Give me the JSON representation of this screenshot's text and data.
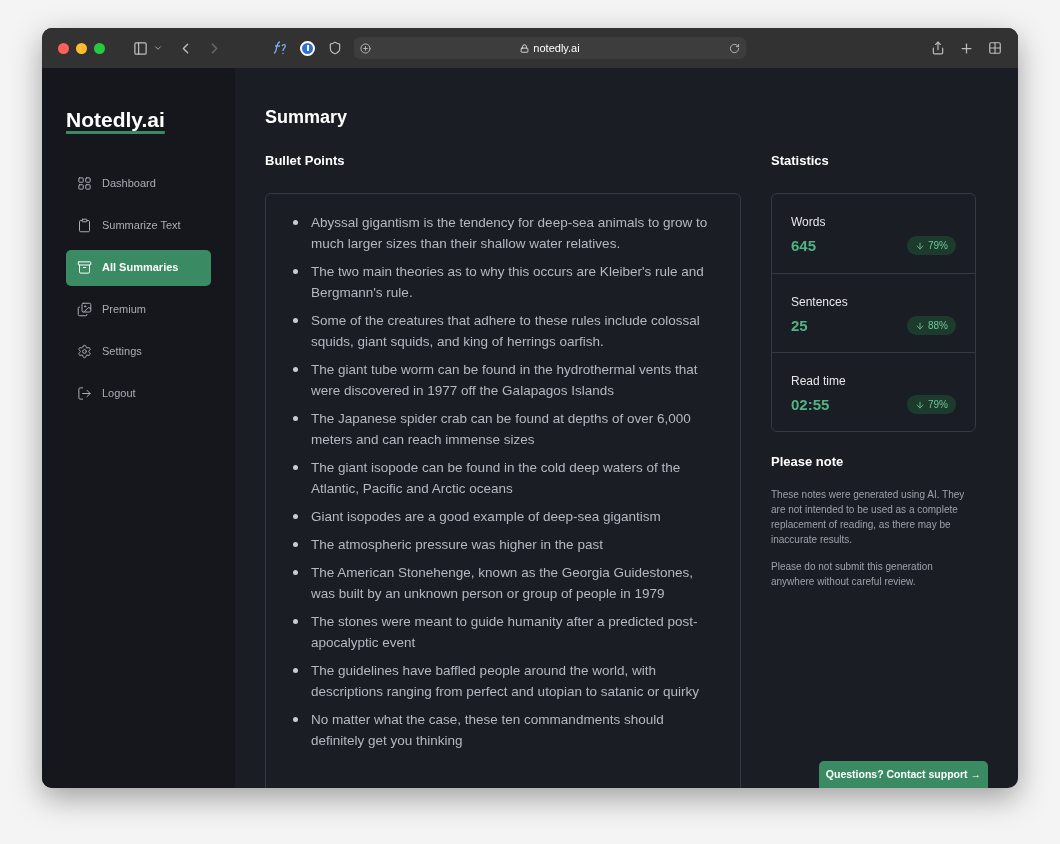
{
  "browser": {
    "url": "notedly.ai"
  },
  "sidebar": {
    "logo": "Notedly.ai",
    "items": [
      {
        "label": "Dashboard",
        "kind": "grid",
        "selected": false
      },
      {
        "label": "Summarize Text",
        "kind": "clipboard",
        "selected": false
      },
      {
        "label": "All Summaries",
        "kind": "archive",
        "selected": true
      },
      {
        "label": "Premium",
        "kind": "premium",
        "selected": false
      },
      {
        "label": "Settings",
        "kind": "settings",
        "selected": false
      },
      {
        "label": "Logout",
        "kind": "logout",
        "selected": false
      }
    ]
  },
  "page_title": "Summary",
  "bullet_points": {
    "heading": "Bullet Points",
    "items": [
      "Abyssal gigantism is the tendency for deep-sea animals to grow to much larger sizes than their shallow water relatives.",
      "The two main theories as to why this occurs are Kleiber's rule and Bergmann's rule.",
      "Some of the creatures that adhere to these rules include colossal squids, giant squids, and king of herrings oarfish.",
      "The giant tube worm can be found in the hydrothermal vents that were discovered in 1977 off the Galapagos Islands",
      "The Japanese spider crab can be found at depths of over 6,000 meters and can reach immense sizes",
      "The giant isopode can be found in the cold deep waters of the Atlantic, Pacific and Arctic oceans",
      "Giant isopodes are a good example of deep-sea gigantism",
      "The atmospheric pressure was higher in the past",
      "The American Stonehenge, known as the Georgia Guidestones, was built by an unknown person or group of people in 1979",
      "The stones were meant to guide humanity after a predicted post-apocalyptic event",
      "The guidelines have baffled people around the world, with descriptions ranging from perfect and utopian to satanic or quirky",
      "No matter what the case, these ten commandments should definitely get you thinking"
    ]
  },
  "statistics": {
    "heading": "Statistics",
    "items": [
      {
        "label": "Words",
        "value": "645",
        "change": "79%"
      },
      {
        "label": "Sentences",
        "value": "25",
        "change": "88%"
      },
      {
        "label": "Read time",
        "value": "02:55",
        "change": "79%"
      }
    ]
  },
  "note": {
    "heading": "Please note",
    "paragraphs": [
      "These notes were generated using AI. They are not intended to be used as a complete replacement of reading, as there may be inaccurate results.",
      "Please do not submit this generation anywhere without careful review."
    ]
  },
  "support_button": "Questions? Contact support →"
}
